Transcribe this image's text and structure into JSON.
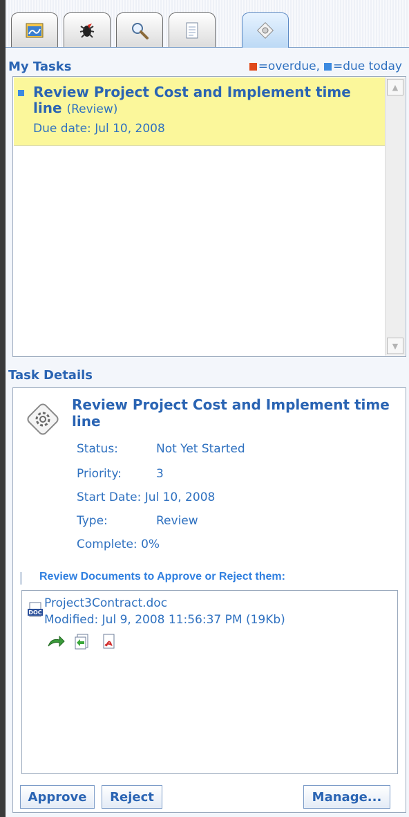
{
  "tabs": [
    {
      "icon": "tasks-calendar-icon"
    },
    {
      "icon": "bug-icon"
    },
    {
      "icon": "search-icon"
    },
    {
      "icon": "document-icon"
    },
    {
      "icon": "workflow-gear-icon",
      "active": true
    }
  ],
  "my_tasks": {
    "title": "My Tasks",
    "legend": {
      "overdue": "=overdue,",
      "due_today": "=due today"
    },
    "colors": {
      "overdue": "#e04a1a",
      "due_today": "#3c8ae0",
      "highlight": "#fbf79b"
    },
    "items": [
      {
        "title": "Review Project Cost and Implement time line",
        "type": "(Review)",
        "due": "Due date: Jul 10, 2008"
      }
    ]
  },
  "details": {
    "title": "Task Details",
    "task_title": "Review Project Cost and Implement time line",
    "properties": [
      {
        "label": "Status:",
        "value": "Not Yet Started"
      },
      {
        "label": "Priority:",
        "value": "3"
      },
      {
        "label": "Start Date:",
        "value": "Jul 10, 2008"
      },
      {
        "label": "Type:",
        "value": "Review"
      },
      {
        "label": "Complete:",
        "value": "0%"
      }
    ],
    "docs_header": "Review Documents to Approve or Reject them:",
    "documents": [
      {
        "name": "Project3Contract.doc",
        "modified": "Modified: Jul 9, 2008 11:56:37 PM (19Kb)"
      }
    ],
    "buttons": {
      "approve": "Approve",
      "reject": "Reject",
      "manage": "Manage..."
    }
  }
}
